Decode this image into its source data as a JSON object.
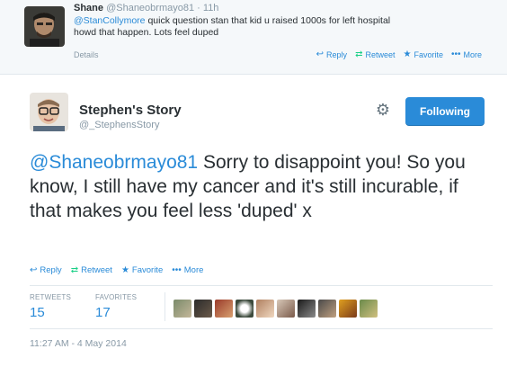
{
  "parent_tweet": {
    "name": "Shane",
    "handle": "@Shaneobrmayo81",
    "dot": "·",
    "time": "11h",
    "mention": "@StanCollymore",
    "text_line1": " quick question stan that kid u raised 1000s for left hospital",
    "text_line2": "howd that happen. Lots feel duped",
    "details": "Details",
    "reply": "Reply",
    "retweet": "Retweet",
    "favorite": "Favorite",
    "more": "More"
  },
  "main_tweet": {
    "name": "Stephen's Story",
    "handle": "@_StephensStory",
    "follow_label": "Following",
    "mention": "@Shaneobrmayo81",
    "text": " Sorry to disappoint you! So you know, I still have my cancer and it's still incurable, if that makes you feel less 'duped' x",
    "reply": "Reply",
    "retweet": "Retweet",
    "favorite": "Favorite",
    "more": "More",
    "retweets_label": "RETWEETS",
    "retweets_count": "15",
    "favorites_label": "FAVORITES",
    "favorites_count": "17",
    "timestamp": "11:27 AM - 4 May 2014"
  },
  "icons": {
    "reply": "reply-arrow-icon",
    "retweet": "retweet-icon",
    "favorite": "star-icon",
    "more": "more-dots-icon",
    "settings": "gear-icon"
  },
  "colors": {
    "link": "#2a8bd8",
    "retweet": "#19cf86",
    "muted": "#8899a6",
    "text": "#292f33",
    "button": "#2a8bd8"
  }
}
